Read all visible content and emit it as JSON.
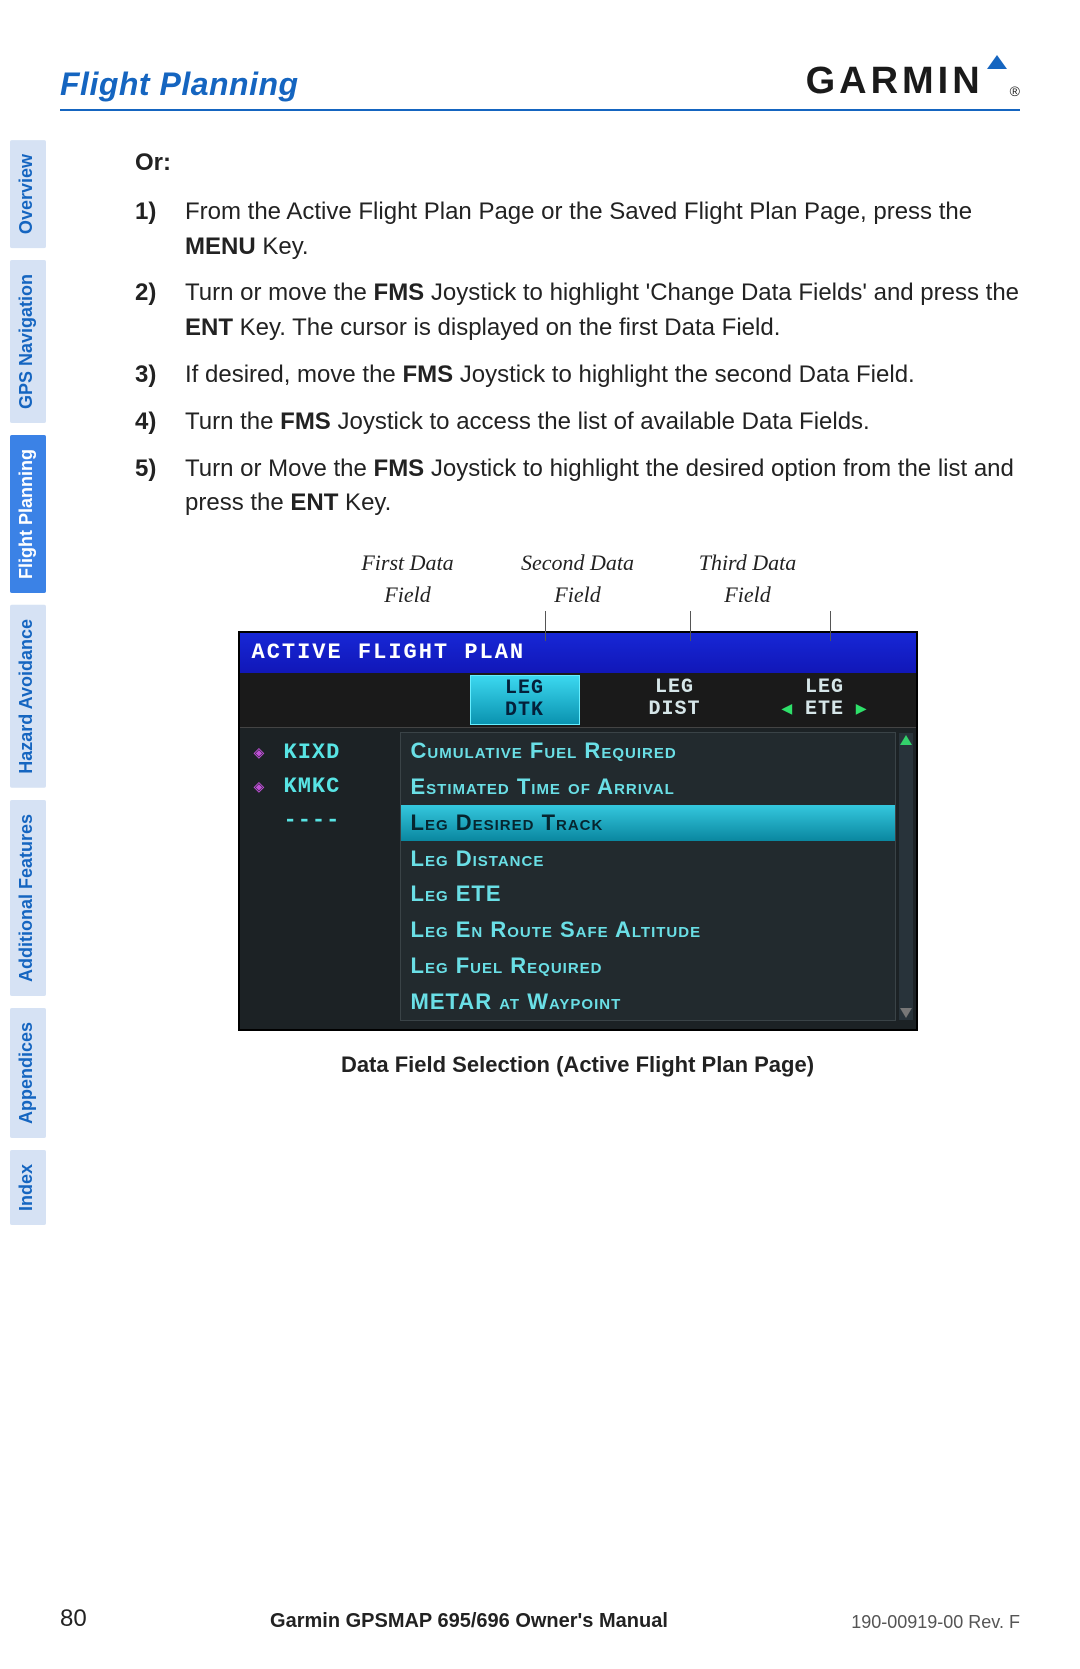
{
  "header": {
    "section_title": "Flight Planning",
    "logo_text": "GARMIN"
  },
  "side_tabs": [
    {
      "label": "Overview",
      "active": false
    },
    {
      "label": "GPS Navigation",
      "active": false
    },
    {
      "label": "Flight Planning",
      "active": true
    },
    {
      "label": "Hazard Avoidance",
      "active": false
    },
    {
      "label": "Additional Features",
      "active": false
    },
    {
      "label": "Appendices",
      "active": false
    },
    {
      "label": "Index",
      "active": false
    }
  ],
  "body": {
    "or_label": "Or:",
    "steps": [
      {
        "n": "1)",
        "pre": "From the Active Flight Plan Page or the Saved Flight Plan Page, press the ",
        "b1": "MENU",
        "mid": " Key.",
        "b2": "",
        "post": ""
      },
      {
        "n": "2)",
        "pre": "Turn or move the ",
        "b1": "FMS",
        "mid": " Joystick to highlight 'Change Data Fields' and press the ",
        "b2": "ENT",
        "post": " Key.  The cursor is displayed on the first Data Field."
      },
      {
        "n": "3)",
        "pre": "If desired, move the ",
        "b1": "FMS",
        "mid": " Joystick to highlight the second Data Field.",
        "b2": "",
        "post": ""
      },
      {
        "n": "4)",
        "pre": "Turn the ",
        "b1": "FMS",
        "mid": " Joystick to access the list of available Data Fields.",
        "b2": "",
        "post": ""
      },
      {
        "n": "5)",
        "pre": "Turn or Move the ",
        "b1": "FMS",
        "mid": " Joystick to highlight the desired option from the list and press the ",
        "b2": "ENT",
        "post": " Key."
      }
    ],
    "callouts": [
      {
        "l1": "First Data",
        "l2": "Field"
      },
      {
        "l1": "Second Data",
        "l2": "Field"
      },
      {
        "l1": "Third Data",
        "l2": "Field"
      }
    ]
  },
  "device": {
    "title": "ACTIVE FLIGHT PLAN",
    "columns": [
      {
        "l1": "LEG",
        "l2": "DTK",
        "active": true,
        "arrows": ""
      },
      {
        "l1": "LEG",
        "l2": "DIST",
        "active": false,
        "arrows": ""
      },
      {
        "l1": "LEG",
        "l2": "ETE",
        "active": false,
        "arrows": "◀  ▶"
      }
    ],
    "waypoints": [
      {
        "sym": "◈",
        "id": "KIXD"
      },
      {
        "sym": "◈",
        "id": "KMKC"
      },
      {
        "sym": "",
        "id": "----"
      }
    ],
    "dropdown": {
      "options": [
        "Cumulative Fuel Required",
        "Estimated Time of Arrival",
        "Leg Desired Track",
        "Leg Distance",
        "Leg ETE",
        "Leg En Route Safe Altitude",
        "Leg Fuel Required",
        "METAR at Waypoint"
      ],
      "selected_index": 2
    }
  },
  "caption": "Data Field Selection (Active Flight Plan Page)",
  "footer": {
    "page_number": "80",
    "manual_title": "Garmin GPSMAP 695/696 Owner's Manual",
    "revision": "190-00919-00  Rev. F"
  }
}
